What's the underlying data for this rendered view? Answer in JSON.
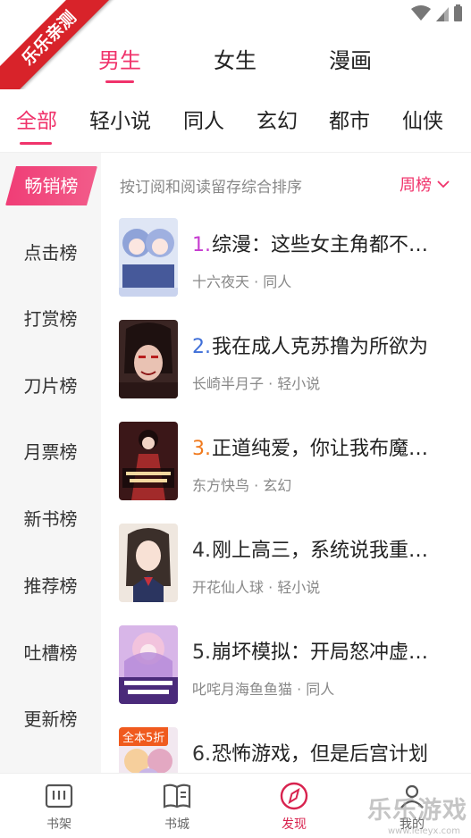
{
  "watermark_banner": "乐乐亲测",
  "watermark_footer": {
    "text": "乐乐游戏",
    "url": "www.leleyx.com"
  },
  "gender_tabs": [
    {
      "label": "男生",
      "active": true
    },
    {
      "label": "女生",
      "active": false
    },
    {
      "label": "漫画",
      "active": false
    }
  ],
  "category_tabs": [
    {
      "label": "全部",
      "active": true
    },
    {
      "label": "轻小说",
      "active": false
    },
    {
      "label": "同人",
      "active": false
    },
    {
      "label": "玄幻",
      "active": false
    },
    {
      "label": "都市",
      "active": false
    },
    {
      "label": "仙侠",
      "active": false
    }
  ],
  "sidebar": {
    "items": [
      {
        "label": "畅销榜",
        "active": true
      },
      {
        "label": "点击榜",
        "active": false
      },
      {
        "label": "打赏榜",
        "active": false
      },
      {
        "label": "刀片榜",
        "active": false
      },
      {
        "label": "月票榜",
        "active": false
      },
      {
        "label": "新书榜",
        "active": false
      },
      {
        "label": "推荐榜",
        "active": false
      },
      {
        "label": "吐槽榜",
        "active": false
      },
      {
        "label": "更新榜",
        "active": false
      }
    ]
  },
  "main": {
    "subtitle": "按订阅和阅读留存综合排序",
    "rank_period": "周榜",
    "books": [
      {
        "rank": "1.",
        "rank_color": "#c63bd0",
        "title": "综漫：这些女主角都不…",
        "author": "十六夜天",
        "genre": "同人",
        "badge": ""
      },
      {
        "rank": "2.",
        "rank_color": "#3f6fd8",
        "title": "我在成人克苏撸为所欲为",
        "author": "长崎半月子",
        "genre": "轻小说",
        "badge": ""
      },
      {
        "rank": "3.",
        "rank_color": "#f07a1e",
        "title": "正道纯爱，你让我布魔…",
        "author": "东方快鸟",
        "genre": "玄幻",
        "badge": ""
      },
      {
        "rank": "4.",
        "rank_color": "#333333",
        "title": "刚上高三，系统说我重…",
        "author": "开花仙人球",
        "genre": "轻小说",
        "badge": ""
      },
      {
        "rank": "5.",
        "rank_color": "#333333",
        "title": "崩坏模拟：开局怒冲虚…",
        "author": "叱咤月海鱼鱼猫",
        "genre": "同人",
        "badge": ""
      },
      {
        "rank": "6.",
        "rank_color": "#333333",
        "title": "恐怖游戏，但是后宫计划",
        "author": "",
        "genre": "",
        "badge": "全本5折"
      }
    ]
  },
  "bottom_nav": [
    {
      "label": "书架",
      "icon": "bookshelf-icon",
      "active": false
    },
    {
      "label": "书城",
      "icon": "book-open-icon",
      "active": false
    },
    {
      "label": "发现",
      "icon": "compass-icon",
      "active": true
    },
    {
      "label": "我的",
      "icon": "profile-icon",
      "active": false
    }
  ],
  "colors": {
    "accent": "#f0336b",
    "sidebar_bg": "#f6f6f6"
  }
}
